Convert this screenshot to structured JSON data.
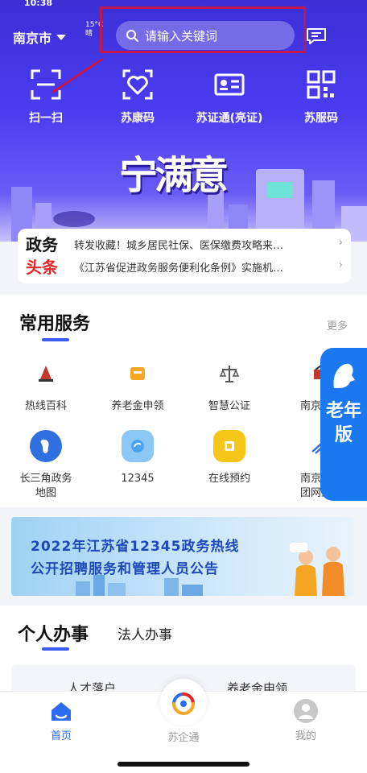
{
  "status": {
    "time": "10:38"
  },
  "header": {
    "city": "南京市",
    "weather_temp": "15°C",
    "weather_desc": "晴",
    "search_placeholder": "请输入关键词"
  },
  "quick_actions": [
    {
      "label": "扫一扫",
      "icon": "scan-icon"
    },
    {
      "label": "苏康码",
      "icon": "health-code-icon"
    },
    {
      "label": "苏证通(亮证)",
      "icon": "id-card-icon"
    },
    {
      "label": "苏服码",
      "icon": "qr-code-icon"
    }
  ],
  "banner": {
    "title": "宁满意"
  },
  "news": {
    "label_line1": "政务",
    "label_line2": "头条",
    "items": [
      "转发收藏！城乡居民社保、医保缴费攻略来…",
      "《江苏省促进政务服务便利化条例》实施机…"
    ],
    "arrow": "›"
  },
  "services": {
    "title": "常用服务",
    "more": "更多",
    "items": [
      {
        "label": "热线百科",
        "icon": "hotline-wiki-icon",
        "color": "#c0392b"
      },
      {
        "label": "养老金申领",
        "icon": "pension-icon",
        "color": "#f5a623"
      },
      {
        "label": "智慧公证",
        "icon": "scales-icon",
        "color": "#555555"
      },
      {
        "label": "南京公…",
        "icon": "nanjing-public-icon",
        "color": "#c0392b"
      },
      {
        "label": "长三角政务\n地图",
        "icon": "map-icon",
        "color": "#2f6fe0"
      },
      {
        "label": "12345",
        "icon": "hotline-12345-icon",
        "color": "#4aa3f0"
      },
      {
        "label": "在线预约",
        "icon": "appointment-icon",
        "color": "#f5c518"
      },
      {
        "label": "南京水务\n团网上…",
        "icon": "water-service-icon",
        "color": "#2f6fe0"
      }
    ]
  },
  "elder_mode": {
    "label": "老年版"
  },
  "promo": {
    "line1": "2022年江苏省12345政务热线",
    "line2": "公开招聘服务和管理人员公告"
  },
  "personal": {
    "tab_active": "个人办事",
    "tab_inactive": "法人办事",
    "items": [
      "人才落户",
      "养老金申领"
    ]
  },
  "tabbar": {
    "home": "首页",
    "center": "苏企通",
    "me": "我的"
  },
  "colors": {
    "hero_top": "#3b2fd6",
    "accent_blue": "#2a6cf0",
    "alert_red": "#e12828",
    "search_highlight": "#c0184c"
  }
}
